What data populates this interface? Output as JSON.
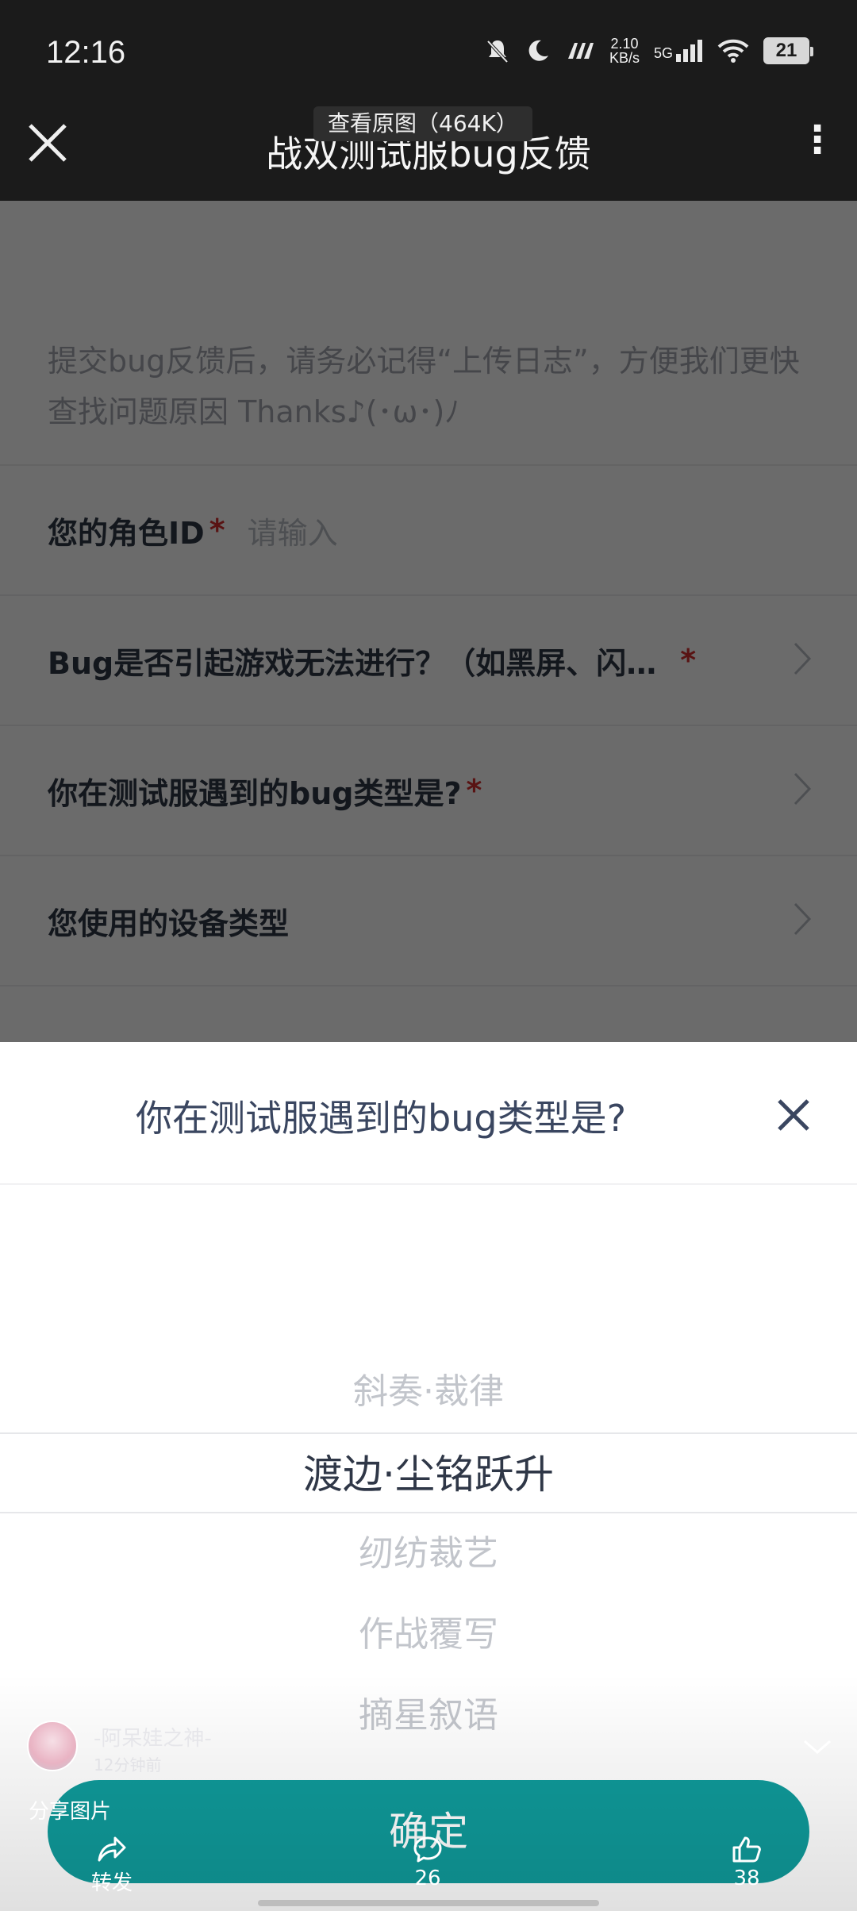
{
  "status_bar": {
    "time": "12:16",
    "net_speed_value": "2.10",
    "net_speed_unit": "KB/s",
    "signal_label": "5G",
    "battery": "21"
  },
  "top_nav": {
    "title": "战双测试服bug反馈",
    "view_original": "查看原图（464K）"
  },
  "form": {
    "note": "提交bug反馈后，请务必记得“上传日志”，方便我们更快查找问题原因 Thanks♪(･ω･)ﾉ",
    "required_mark": "*",
    "role_id": {
      "label": "您的角色ID",
      "placeholder": "请输入"
    },
    "questions": [
      {
        "label": "Bug是否引起游戏无法进行？（如黑屏、闪…",
        "required": true
      },
      {
        "label": "你在测试服遇到的bug类型是?",
        "required": true
      },
      {
        "label": "您使用的设备类型",
        "required": false
      }
    ]
  },
  "picker": {
    "title": "你在测试服遇到的bug类型是?",
    "options": [
      "斜奏·裁律",
      "渡边·尘铭跃升",
      "纫纺裁艺",
      "作战覆写",
      "摘星叙语"
    ],
    "selected_index": 1,
    "confirm_label": "确定"
  },
  "viewer": {
    "author": "-阿呆娃之神-",
    "posted": "12分钟前",
    "share_image": "分享图片",
    "forward_label": "转发",
    "comments_count": "26",
    "likes_count": "38"
  },
  "colors": {
    "accent": "#0f9a9a",
    "dark_bar": "#1b1b1b",
    "required": "#d32f2f"
  }
}
